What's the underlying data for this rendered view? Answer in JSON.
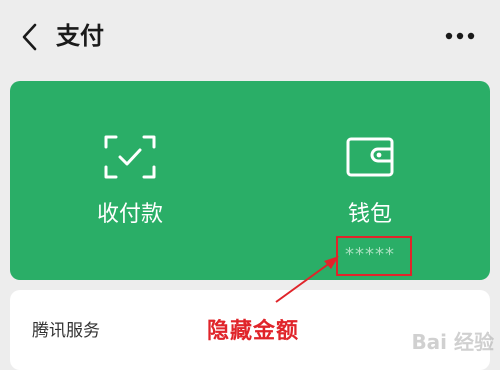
{
  "header": {
    "title": "支付"
  },
  "card": {
    "background": "#2aae67",
    "items": [
      {
        "label": "收付款",
        "icon": "scan-check-icon"
      },
      {
        "label": "钱包",
        "icon": "wallet-icon",
        "balance": "*****"
      }
    ]
  },
  "section": {
    "title": "腾讯服务"
  },
  "annotation": {
    "text": "隐藏金额",
    "color": "#e0242a"
  },
  "watermark": {
    "text": "Bai 经验"
  }
}
